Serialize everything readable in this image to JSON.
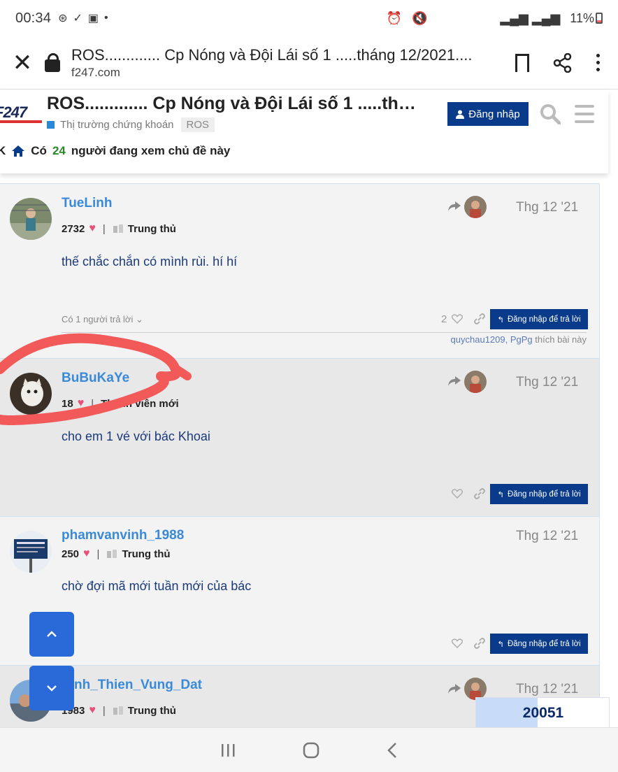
{
  "status_bar": {
    "time": "00:34",
    "battery": "11%"
  },
  "browser": {
    "title": "ROS............. Cp Nóng và Đội Lái số 1 .....tháng 12/2021....",
    "url": "f247.com"
  },
  "site": {
    "logo": "F247",
    "topic_title": "ROS............. Cp Nóng và Đội Lái số 1 .....thán...",
    "category": "Thị trường chứng khoán",
    "tag": "ROS",
    "login_label": "Đăng nhập",
    "viewers_prefix": "Có",
    "viewers_count": "24",
    "viewers_suffix": "người đang xem chủ đề này",
    "viewers_lead": "K"
  },
  "posts": [
    {
      "username": "TueLinh",
      "likes_received": "2732",
      "title": "Trung thủ",
      "date": "Thg 12 '21",
      "content": "thế chắc chắn có mình rùi. hí hí",
      "replies_toggle": "Có 1 người trả lời",
      "like_count": "2",
      "reply_label": "Đăng nhập để trả lời",
      "liked_by_names": "quychau1209, PgPg",
      "liked_by_suffix": "thích bài này"
    },
    {
      "username": "BuBuKaYe",
      "likes_received": "18",
      "title": "Thành viên mới",
      "date": "Thg 12 '21",
      "content": "cho em 1 vé với bác Khoai",
      "reply_label": "Đăng nhập để trả lời"
    },
    {
      "username": "phamvanvinh_1988",
      "likes_received": "250",
      "title": "Trung thủ",
      "date": "Thg 12 '21",
      "content": "chờ đợi mã mới tuần mới của bác",
      "reply_label": "Đăng nhập để trả lời"
    },
    {
      "username": "nh_Thien_Vung_Dat",
      "likes_received": "1983",
      "title": "Trung thủ",
      "date": "Thg 12 '21"
    }
  ],
  "counter": "20051",
  "colors": {
    "brand_blue": "#0a3b8a",
    "link_blue": "#3a8ad8",
    "fab_blue": "#2a6ad8",
    "heart": "#e8507a",
    "scribble": "#f25a5a"
  }
}
